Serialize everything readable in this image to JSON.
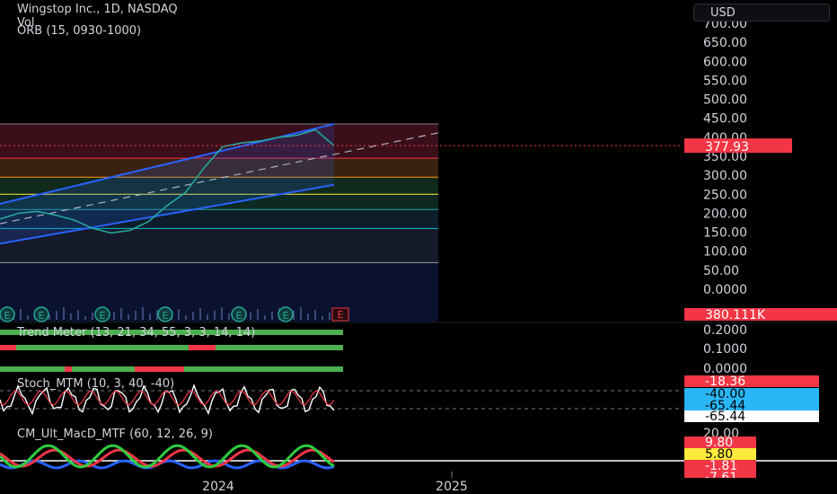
{
  "header": {
    "symbol_line": "Wingstop Inc., 1D, NASDAQ",
    "vol_label": "Vol",
    "orb_label": "ORB (15, 0930-1000)",
    "currency": "USD"
  },
  "colors": {
    "background": "#000000",
    "channel": "#2962ff",
    "price": "#26a69a",
    "last_price_tag": "#f23645",
    "trend_green": "#4caf50",
    "trend_red": "#f23645",
    "stoch_line": "#ffffff",
    "stoch_red": "#f23645",
    "macd_green": "#2ecc40",
    "macd_red": "#f23645",
    "macd_blue": "#2962ff",
    "macd_yellow": "#ffeb3b"
  },
  "chart_data": [
    {
      "type": "line",
      "name": "price",
      "ylim": [
        0,
        700
      ],
      "y_ticks": [
        "0.0000",
        "50.00",
        "100.00",
        "150.00",
        "200.00",
        "250.00",
        "300.00",
        "350.00",
        "400.00",
        "450.00",
        "500.00",
        "550.00",
        "600.00",
        "650.00",
        "700.00"
      ],
      "y_tick_values": [
        0,
        50,
        100,
        150,
        200,
        250,
        300,
        350,
        400,
        450,
        500,
        550,
        600,
        650,
        700
      ],
      "x_ticks": [
        "2024",
        "2025"
      ],
      "last_price": "377.93",
      "volume_tag": "380.111K",
      "earnings_marker": "E",
      "x": [
        "2023-04",
        "2023-05",
        "2023-06",
        "2023-07",
        "2023-08",
        "2023-09",
        "2023-10",
        "2023-11",
        "2023-12",
        "2024-01",
        "2024-02",
        "2024-03",
        "2024-04",
        "2024-05",
        "2024-06",
        "2024-07",
        "2024-08",
        "2024-09",
        "2024-10"
      ],
      "values": [
        185,
        200,
        205,
        195,
        182,
        160,
        148,
        155,
        178,
        220,
        255,
        320,
        375,
        385,
        390,
        400,
        405,
        420,
        378
      ],
      "orb_levels": [
        345,
        295,
        250,
        210,
        160,
        70
      ],
      "channel": {
        "lower_start": 120,
        "lower_end": 275,
        "upper_start": 225,
        "upper_end": 435
      }
    },
    {
      "type": "bar",
      "name": "Trend Meter (13, 21, 34, 55, 3, 3, 14, 14)",
      "title": "Trend Meter (13, 21, 34, 55, 3, 3, 14, 14)",
      "ylim": [
        0,
        0.2
      ],
      "y_ticks": [
        "0.0000",
        "0.1000",
        "0.2000"
      ],
      "rows": 3
    },
    {
      "type": "line",
      "name": "Stoch_MTM (10, 3, 40, -40)",
      "title": "Stoch_MTM (10, 3, 40, -40)",
      "value_tags": [
        "-18.36",
        "-40.00",
        "-65.44",
        "-65.44"
      ]
    },
    {
      "type": "line",
      "name": "CM_Ult_MacD_MTF (60, 12, 26, 9)",
      "title": "CM_Ult_MacD_MTF (60, 12, 26, 9)",
      "y_ticks": [
        "20.00"
      ],
      "value_tags": [
        "9.80",
        "5.80",
        "-1.81",
        "-7.61"
      ]
    }
  ]
}
